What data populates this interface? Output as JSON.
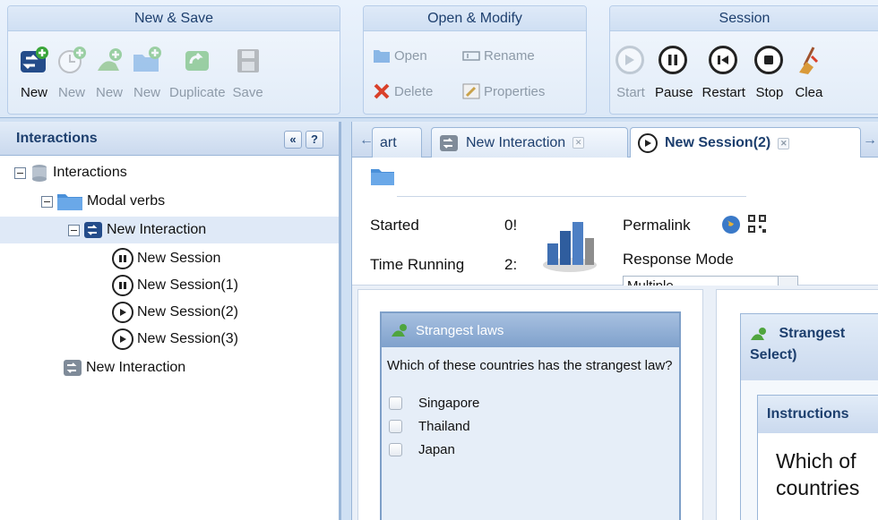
{
  "ribbon": {
    "groups": {
      "new_save": {
        "title": "New & Save",
        "buttons": {
          "new": "New",
          "new_clock": "New",
          "new_group": "New",
          "new_folder": "New",
          "duplicate": "Duplicate",
          "save": "Save"
        }
      },
      "open_modify": {
        "title": "Open & Modify",
        "buttons": {
          "open": "Open",
          "rename": "Rename",
          "delete": "Delete",
          "properties": "Properties"
        }
      },
      "session": {
        "title": "Session",
        "buttons": {
          "start": "Start",
          "pause": "Pause",
          "restart": "Restart",
          "stop": "Stop",
          "clear": "Clea"
        }
      }
    }
  },
  "left_panel": {
    "title": "Interactions",
    "collapse_glyph": "«",
    "help_glyph": "?",
    "tree": [
      "Interactions",
      "Modal verbs",
      "New Interaction",
      "New Session",
      "New Session(1)",
      "New Session(2)",
      "New Session(3)",
      "New Interaction"
    ]
  },
  "tabs": {
    "left_arrow": "←",
    "right_arrow": "→",
    "start_partial": "art",
    "interaction": "New Interaction",
    "session": "New Session(2)",
    "close_glyph": "✕"
  },
  "session_info": {
    "started_label": "Started",
    "started_value": "0!",
    "time_label": "Time Running",
    "time_value": "2:",
    "permalink_label": "Permalink",
    "response_label": "Response Mode",
    "response_value": "Multiple"
  },
  "card_left": {
    "title": "Strangest laws",
    "question": "Which of these countries has the strangest law?",
    "options": [
      "Singapore",
      "Thailand",
      "Japan"
    ]
  },
  "card_right": {
    "title_line1": "Strangest",
    "title_line2": "Select)",
    "instructions": "Instructions",
    "question_line1": "Which of",
    "question_line2": "countries"
  },
  "colors": {
    "accent": "#1d3f6e",
    "panel": "#cad9ee",
    "card_head": "#7fa1cc"
  }
}
